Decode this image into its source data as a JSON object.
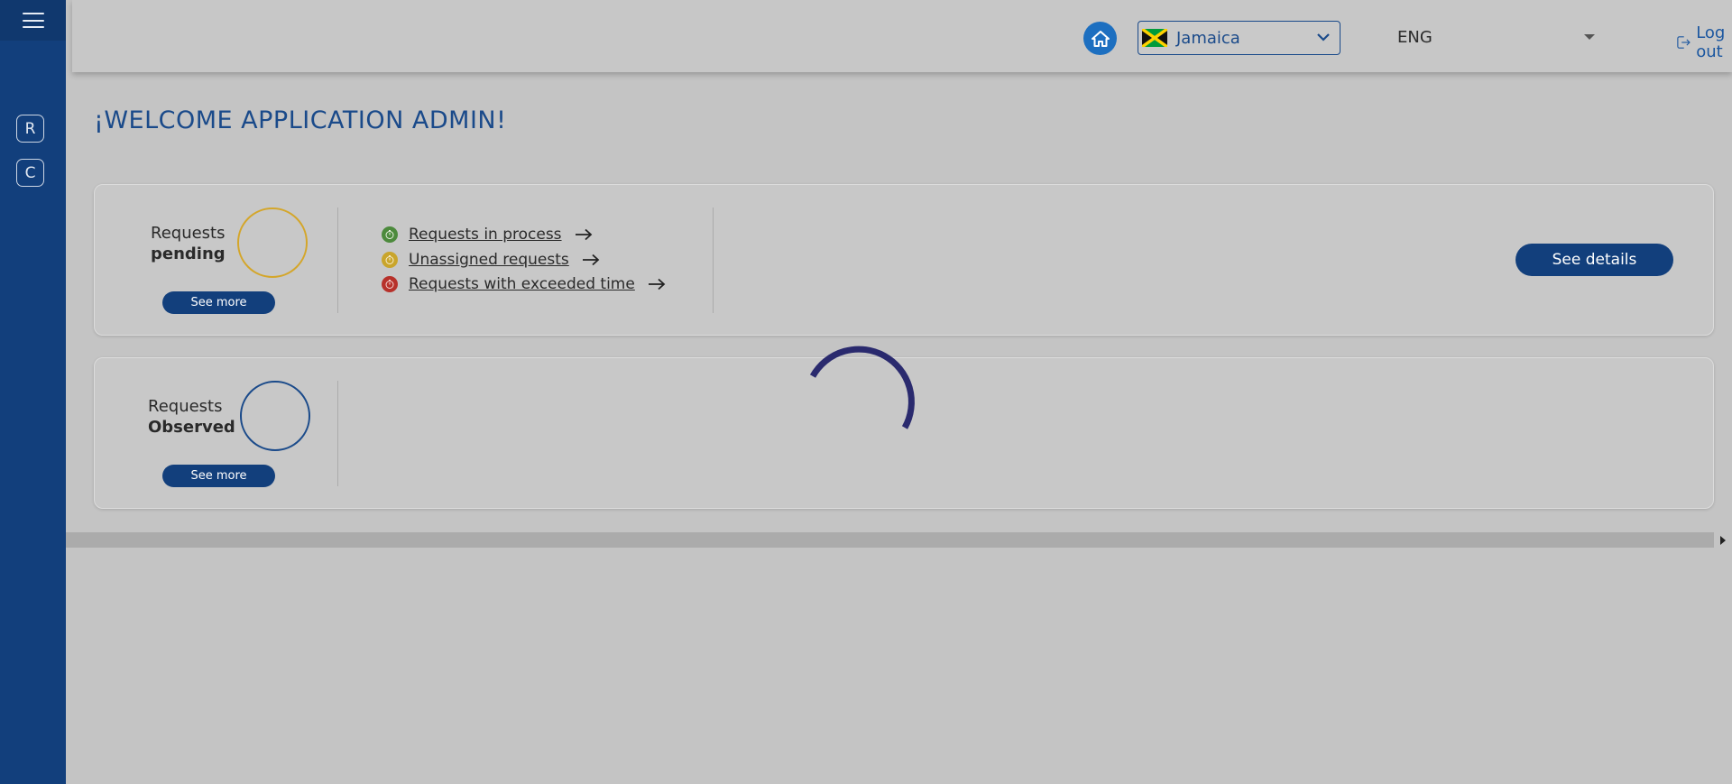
{
  "header": {
    "country": "Jamaica",
    "language": "ENG",
    "logout_label": "Log out"
  },
  "sidebar": {
    "items": [
      {
        "letter": "R"
      },
      {
        "letter": "C"
      }
    ]
  },
  "welcome": "¡WELCOME APPLICATION ADMIN!",
  "pending_card": {
    "label_top": "Requests",
    "label_bold": "pending",
    "see_more": "See more",
    "links": [
      {
        "text": "Requests in process",
        "color": "#4c8a3c"
      },
      {
        "text": "Unassigned requests",
        "color": "#c9a52b"
      },
      {
        "text": "Requests with exceeded time",
        "color": "#b7312a"
      }
    ],
    "see_details": "See details"
  },
  "observed_card": {
    "label_top": "Requests",
    "label_bold": "Observed",
    "see_more": "See more"
  },
  "colors": {
    "brand": "#123f7c",
    "pending_ring": "#d4a62a",
    "observed_ring": "#1a4a8a",
    "spinner": "#2a2a6e"
  }
}
